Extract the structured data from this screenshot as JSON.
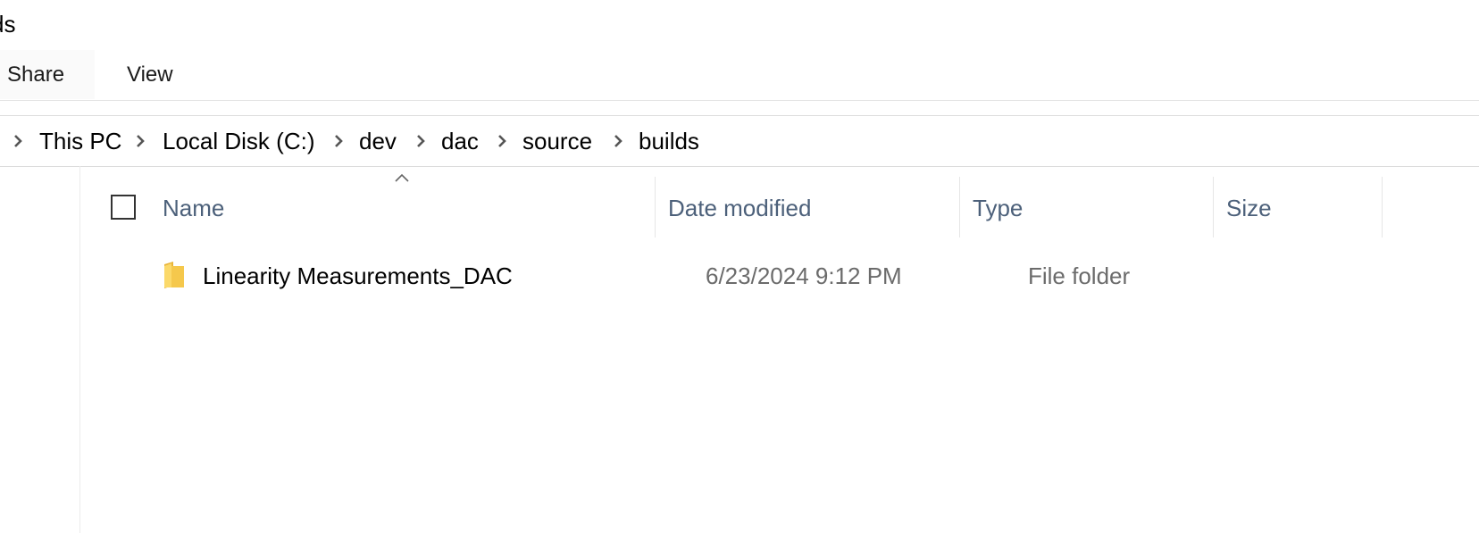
{
  "window": {
    "title": "ds"
  },
  "ribbon": {
    "tabs": [
      "Share",
      "View"
    ]
  },
  "address_bar": {
    "crumbs": [
      "This PC",
      "Local Disk (C:)",
      "dev",
      "dac",
      "source",
      "builds"
    ]
  },
  "file_list": {
    "columns": [
      "Name",
      "Date modified",
      "Type",
      "Size"
    ],
    "sorted_column": "Name",
    "rows": [
      {
        "name": "Linearity Measurements_DAC",
        "date_modified": "6/23/2024 9:12 PM",
        "type": "File folder",
        "size": "",
        "icon": "folder-icon"
      }
    ]
  },
  "colors": {
    "header_text": "#4c607a",
    "secondary_text": "#6b6b6b",
    "folder": "#f5c84c"
  }
}
